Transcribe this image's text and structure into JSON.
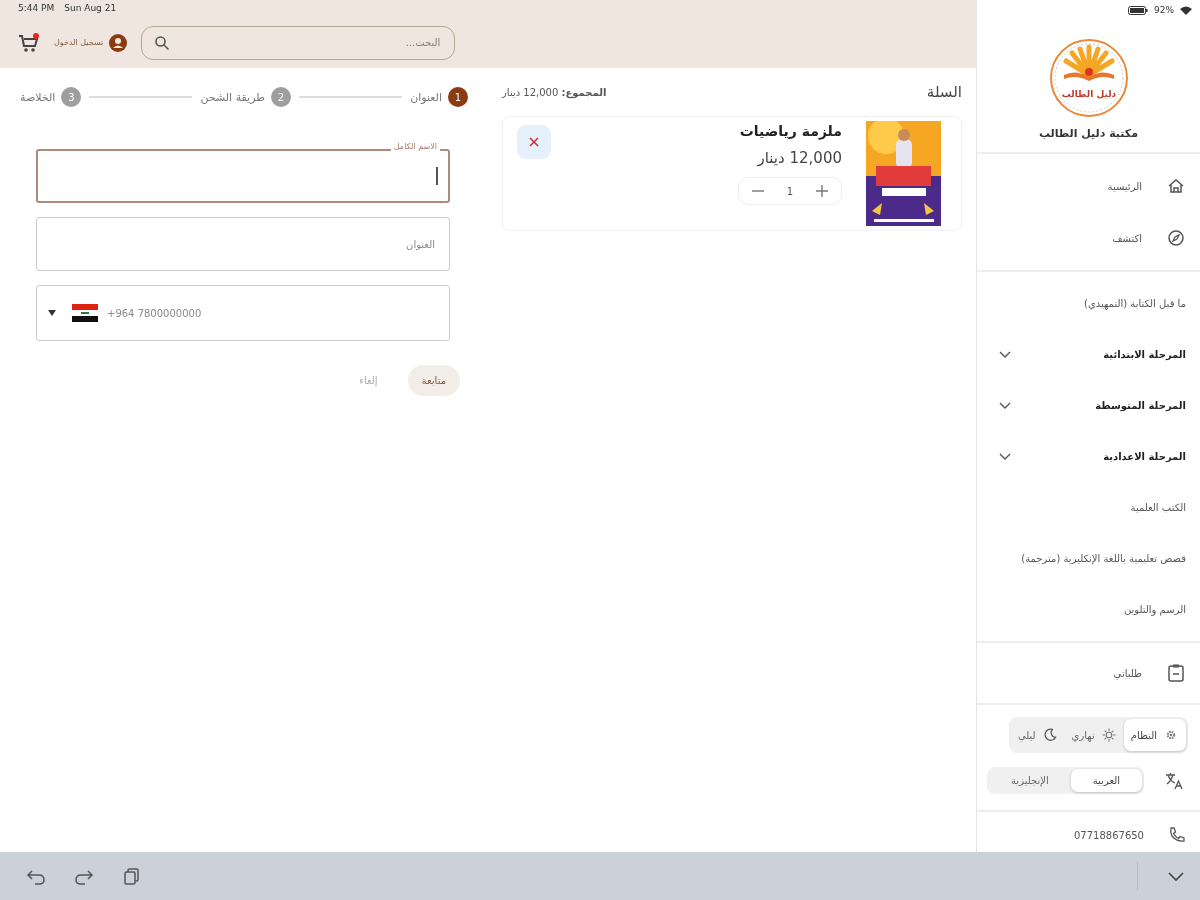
{
  "status_bar": {
    "time": "5:44 PM",
    "date": "Sun Aug 21",
    "battery": "92%"
  },
  "header": {
    "search": {
      "placeholder": "البحث..."
    },
    "login": "تسجيل الدخول",
    "cart_badge": true
  },
  "steps": [
    {
      "number": "1",
      "label": "العنوان",
      "selected": true
    },
    {
      "number": "2",
      "label": "طريقة الشحن",
      "selected": false
    },
    {
      "number": "3",
      "label": "الخلاصة",
      "selected": false
    }
  ],
  "form": {
    "fields": [
      {
        "kind": "text",
        "label": "الاسم الكامل",
        "focused": true
      },
      {
        "kind": "text",
        "placeholder": "العنوان",
        "focused": false
      },
      {
        "kind": "phone",
        "placeholder": "+964 7800000000",
        "focused": false
      }
    ],
    "buttons": [
      {
        "label": "متابعة",
        "primary": true
      },
      {
        "label": "إلغاء",
        "primary": false
      }
    ]
  },
  "cart": {
    "title": "السلة",
    "total": "**المجموع:** 12,000 دينار",
    "items": [
      {
        "name": "ملزمة رياضيات",
        "price": "12,000 دينار",
        "quantity": "1"
      }
    ]
  },
  "sidebar": {
    "logo_text": "دليل الطالب",
    "store_name": "مكتبة دليل الطالب",
    "nav": [
      {
        "label": "الرئيسية"
      },
      {
        "label": "اكتشف"
      }
    ],
    "categories": [
      {
        "label": "ما قبل الكتابة (التمهيدي)",
        "kind": "link"
      },
      {
        "label": "المرحلة الابتدائية",
        "kind": "group"
      },
      {
        "label": "المرحلة المتوسطة",
        "kind": "group"
      },
      {
        "label": "المرحلة الاعدادية",
        "kind": "group"
      },
      {
        "label": "الكتب العلمية",
        "kind": "link"
      },
      {
        "label": "قصص تعليمية باللغة الإنكليزية (مترجمة)",
        "kind": "link"
      },
      {
        "label": "الرسم والتلوين",
        "kind": "link"
      }
    ],
    "orders": "طلباتي",
    "theme": [
      {
        "label": "النظام",
        "selected": true
      },
      {
        "label": "نهاري",
        "selected": false
      },
      {
        "label": "ليلي",
        "selected": false
      }
    ],
    "language": [
      {
        "label": "العربية",
        "selected": true
      },
      {
        "label": "الإنجليزية",
        "selected": false
      }
    ],
    "phone": "07718867650"
  }
}
